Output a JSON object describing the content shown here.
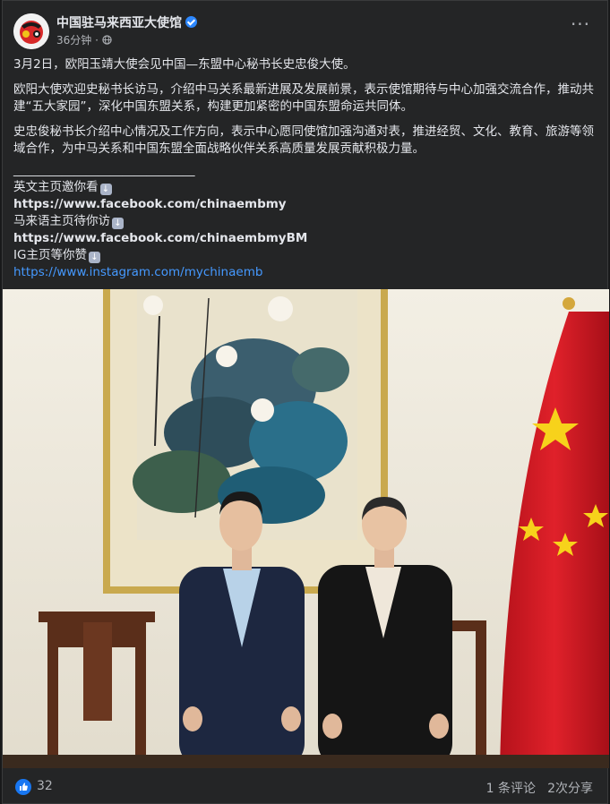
{
  "post": {
    "author": "中国驻马来西亚大使馆",
    "time": "36分钟",
    "visibility_icon": "globe-icon",
    "paragraphs": [
      "3月2日，欧阳玉靖大使会见中国—东盟中心秘书长史忠俊大使。",
      "欧阳大使欢迎史秘书长访马，介绍中马关系最新进展及发展前景，表示使馆期待与中心加强交流合作，推动共建“五大家园”，深化中国东盟关系，构建更加紧密的中国东盟命运共同体。",
      "史忠俊秘书长介绍中心情况及工作方向，表示中心愿同使馆加强沟通对表，推进经贸、文化、教育、旅游等领域合作，为中马关系和中国东盟全面战略伙伴关系高质量发展贡献积极力量。"
    ],
    "divider": "______________________________",
    "links": {
      "en_label": "英文主页邀你看",
      "en_url": "https://www.facebook.com/chinaembmy",
      "bm_label": "马来语主页待你访",
      "bm_url": "https://www.facebook.com/chinaembmyBM",
      "ig_label": "IG主页等你赞",
      "ig_url": "https://www.instagram.com/mychinaemb"
    }
  },
  "reactions": {
    "like_count": "32",
    "comments": "1 条评论",
    "shares": "2次分享"
  },
  "colors": {
    "background": "#242526",
    "link": "#4599ff",
    "like": "#1877f2"
  }
}
